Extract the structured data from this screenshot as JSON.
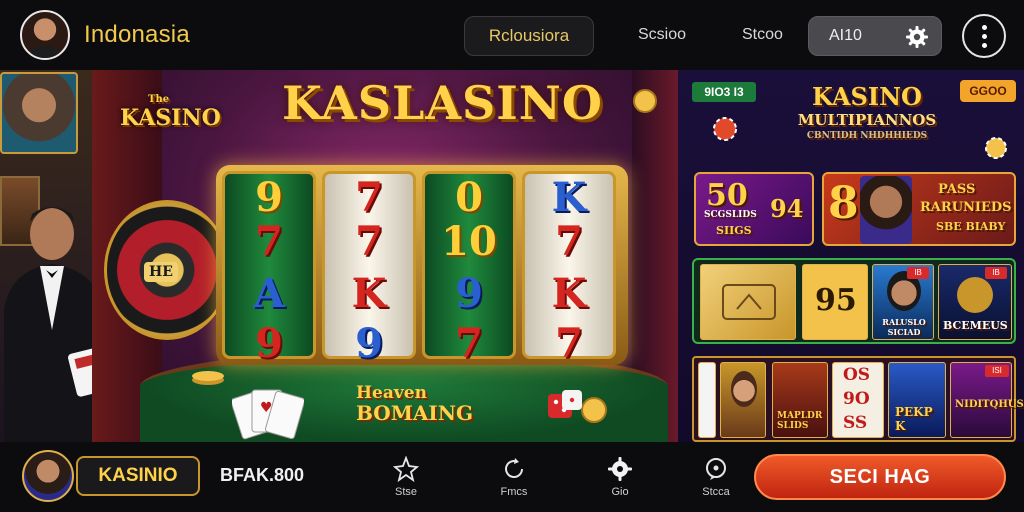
{
  "header": {
    "region": "Indonasia",
    "tab_button": "Rclousiora",
    "nav_1": "Scsioo",
    "nav_2": "Stcoo",
    "auto_label": "AI10"
  },
  "game": {
    "logo_small": "KASINO",
    "logo_small_prefix": "The",
    "logo_big": "KASLASINO",
    "roulette_label": "HE",
    "bonus_line_1": "Heaven",
    "bonus_line_2": "BOMAING",
    "reels": [
      [
        "9",
        "7",
        "A",
        "9"
      ],
      [
        "7",
        "7",
        "K",
        "9"
      ],
      [
        "0",
        "10",
        "9",
        "7"
      ],
      [
        "K",
        "7",
        "K",
        "7"
      ]
    ]
  },
  "right_panel": {
    "badge_left": "9IO3 I3",
    "badge_right": "GGOO",
    "title_1": "KASINO",
    "title_2": "MULTIPIANNOS",
    "title_3": "CBNTIDH NHDHHIEDS",
    "promo_1_big": "50",
    "promo_1_sub": "SCGSLIDS",
    "promo_1_foot": "SIIGS",
    "promo_1_num": "94",
    "promo_2_big": "8",
    "promo_2_line_1": "PASS",
    "promo_2_line_2": "RARUNIEDS",
    "promo_2_line_3": "SBE BIABY",
    "row3_num": "95",
    "row3_person_label": "RALUSLO SICIAD",
    "row3_right_label": "BCEMEUS",
    "row3_badge_1": "IB",
    "row3_badge_2": "IB",
    "row4_text_1": "OS",
    "row4_text_2": "9O",
    "row4_text_3": "SS",
    "row4_label_1": "MAPLDR SLIDS",
    "row4_label_2": "PEKP K",
    "row4_label_3": "NIDITQHUS",
    "row4_badge": "ISI"
  },
  "footer": {
    "brand": "KASINIO",
    "balance": "BFAK.800",
    "tools": [
      {
        "label": "Stse"
      },
      {
        "label": "Fmcs"
      },
      {
        "label": "Gio"
      },
      {
        "label": "Stcca"
      }
    ],
    "spin": "SECI HAG"
  },
  "colors": {
    "accent_gold": "#ffd24a",
    "spin_red": "#d8341a",
    "felt_green": "#1f7a3a"
  }
}
